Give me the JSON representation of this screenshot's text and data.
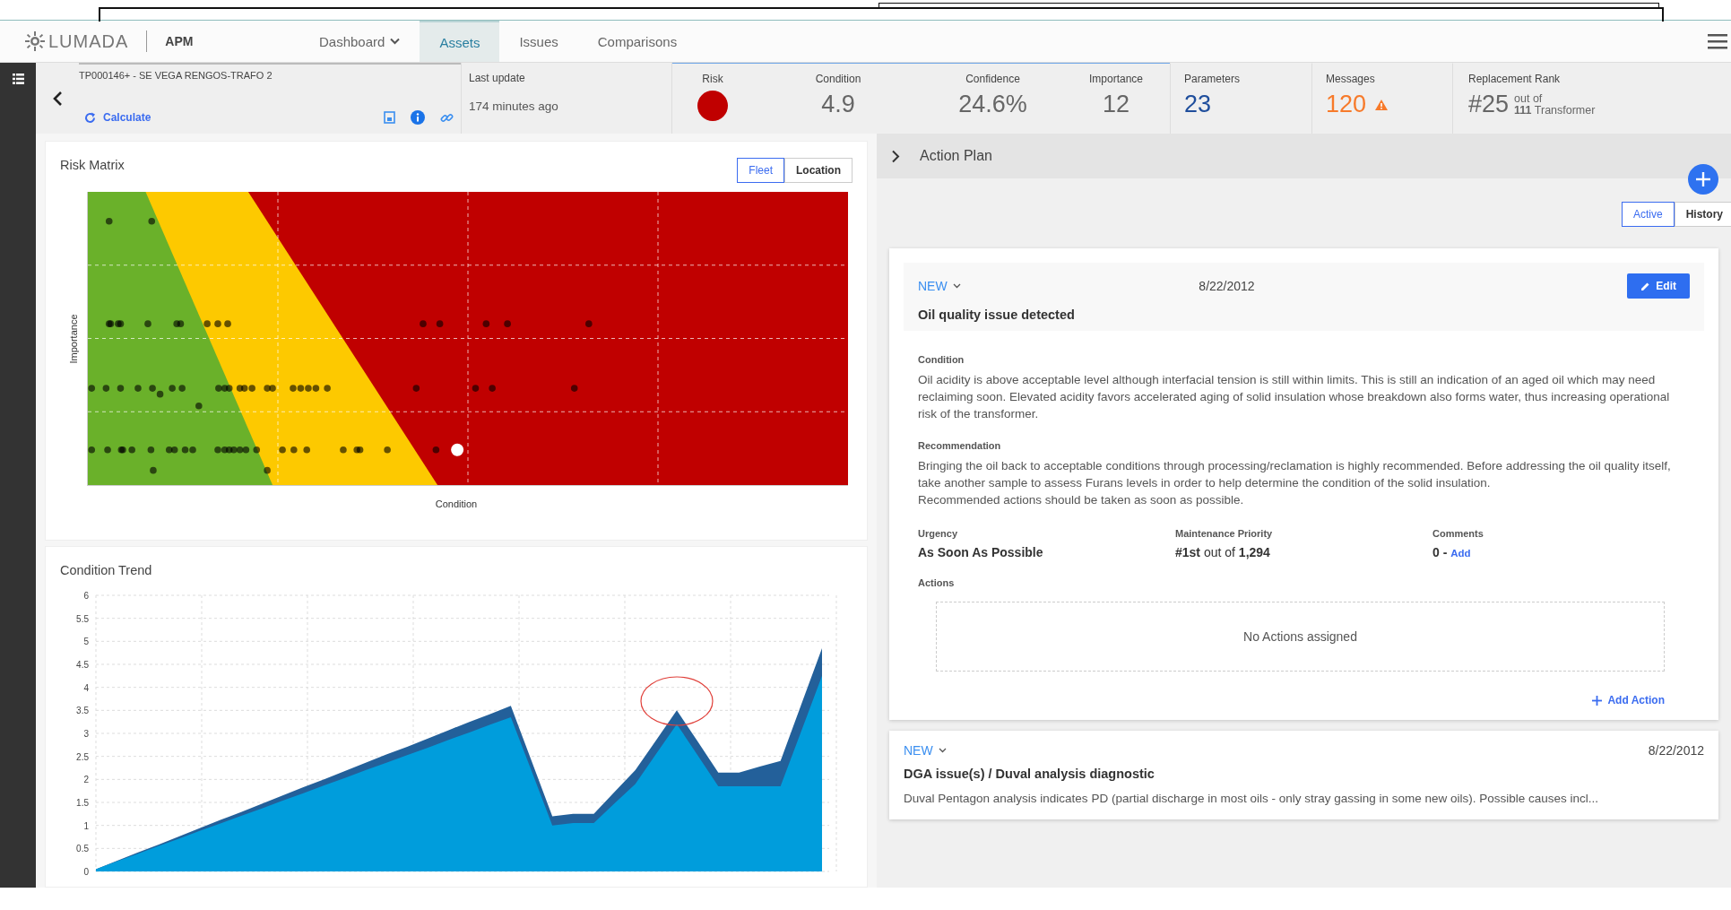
{
  "header": {
    "logo": "LUMADA",
    "product": "APM",
    "nav": [
      {
        "label": "Dashboard",
        "selected": false,
        "dropdown": true
      },
      {
        "label": "Assets",
        "selected": true,
        "dropdown": false
      },
      {
        "label": "Issues",
        "selected": false,
        "dropdown": false
      },
      {
        "label": "Comparisons",
        "selected": false,
        "dropdown": false
      }
    ]
  },
  "asset": {
    "name": "TP000146+ - SE VEGA RENGOS-TRAFO 2",
    "calculate": "Calculate"
  },
  "last_update": {
    "label": "Last update",
    "value": "174 minutes ago"
  },
  "metrics": [
    {
      "kind": "dot",
      "label": "Risk",
      "color": "#c00000"
    },
    {
      "kind": "number",
      "label": "Condition",
      "value": "4.9"
    },
    {
      "kind": "number",
      "label": "Confidence",
      "value": "24.6%"
    },
    {
      "kind": "number",
      "label": "Importance",
      "value": "12"
    },
    {
      "kind": "count",
      "label": "Parameters",
      "value": "23",
      "color": "#1f4e9c"
    },
    {
      "kind": "warning",
      "label": "Messages",
      "value": "120",
      "color": "#f77a2a"
    },
    {
      "kind": "rank",
      "label": "Replacement Rank",
      "value": "#25",
      "out_of": "out of",
      "total": "111",
      "unit": "Transformer"
    }
  ],
  "risk_matrix": {
    "title": "Risk Matrix",
    "toggle": [
      {
        "label": "Fleet",
        "selected": true
      },
      {
        "label": "Location",
        "selected": false
      }
    ],
    "ylabel": "Importance",
    "xlabel": "Condition"
  },
  "condition_trend": {
    "title": "Condition Trend",
    "chart_data": {
      "type": "area",
      "grid": true,
      "series": [
        {
          "color": "#23609a",
          "values": [
            0.05,
            0.23,
            0.41,
            0.58,
            0.76,
            0.94,
            1.12,
            1.29,
            1.47,
            1.65,
            1.83,
            2.0,
            2.18,
            2.36,
            2.54,
            2.71,
            2.89,
            3.07,
            3.25,
            3.42,
            3.6,
            2.4,
            1.2,
            1.25,
            1.25,
            1.73,
            2.2,
            2.85,
            3.5,
            2.83,
            2.15,
            2.15,
            2.28,
            2.4,
            3.63,
            4.85
          ]
        },
        {
          "color": "#009ddc",
          "values": [
            0.05,
            0.22,
            0.38,
            0.55,
            0.71,
            0.88,
            1.04,
            1.21,
            1.37,
            1.54,
            1.7,
            1.87,
            2.03,
            2.2,
            2.36,
            2.53,
            2.69,
            2.86,
            3.02,
            3.19,
            3.35,
            2.18,
            1.0,
            1.05,
            1.05,
            1.48,
            1.9,
            2.55,
            3.2,
            2.53,
            1.85,
            1.85,
            1.85,
            1.85,
            3.05,
            4.25
          ]
        }
      ],
      "ylim": [
        0,
        6
      ],
      "yticks": [
        0,
        0.5,
        1,
        1.5,
        2,
        2.5,
        3,
        3.5,
        4,
        4.5,
        5,
        5.5,
        6
      ]
    }
  },
  "action_plan": {
    "title": "Action Plan",
    "tabs": [
      {
        "label": "Active",
        "selected": true
      },
      {
        "label": "History",
        "selected": false
      }
    ],
    "issues": [
      {
        "status": "NEW",
        "date": "8/22/2012",
        "title": "Oil quality issue detected",
        "expanded": true,
        "edit": "Edit",
        "condition_label": "Condition",
        "condition": "Oil acidity is above acceptable level although interfacial tension is still within limits.  This is still an indication of an aged oil which may need reclaiming soon.  Elevated acidity favors accelerated aging of solid insulation whose breakdown also forms water, thus increasing operational risk of the transformer.",
        "recommendation_label": "Recommendation",
        "recommendation": [
          "Bringing the oil back to acceptable conditions through processing/reclamation is highly recommended.  Before addressing the oil quality itself, take another sample to assess Furans levels in order to help determine the condition of the solid insulation.",
          "Recommended actions should be taken as soon as possible."
        ],
        "urgency_label": "Urgency",
        "urgency": "As Soon As Possible",
        "priority_label": "Maintenance Priority",
        "priority": "**#1st** out of **1,294**",
        "comments_label": "Comments",
        "comments": "0 -",
        "comments_link": "Add",
        "actions_label": "Actions",
        "actions_empty": "No Actions assigned",
        "add_action": "Add Action"
      },
      {
        "status": "NEW",
        "date": "8/22/2012",
        "title": "DGA issue(s) / Duval analysis diagnostic",
        "expanded": false,
        "summary": "Duval Pentagon analysis indicates PD (partial discharge in most oils - only stray gassing in some new oils). Possible causes incl..."
      }
    ]
  }
}
